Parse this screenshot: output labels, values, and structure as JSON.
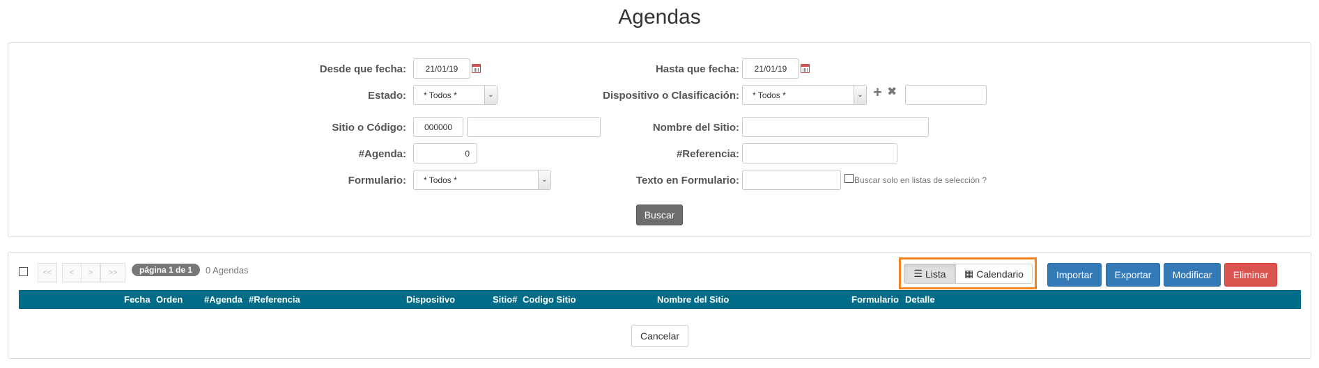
{
  "page": {
    "title": "Agendas"
  },
  "filters": {
    "desde_label": "Desde que fecha:",
    "desde_value": "21/01/19",
    "hasta_label": "Hasta que fecha:",
    "hasta_value": "21/01/19",
    "estado_label": "Estado:",
    "estado_value": "* Todos *",
    "dispositivo_label": "Dispositivo o Clasificación:",
    "dispositivo_value": "* Todos *",
    "dispositivo_extra_value": "",
    "sitio_label": "Sitio o Código:",
    "sitio_code_value": "000000",
    "sitio_text_value": "",
    "nombre_sitio_label": "Nombre del Sitio:",
    "nombre_sitio_value": "",
    "agenda_label": "#Agenda:",
    "agenda_value": "0",
    "referencia_label": "#Referencia:",
    "referencia_value": "",
    "formulario_label": "Formulario:",
    "formulario_value": "* Todos *",
    "texto_formulario_label": "Texto en Formulario:",
    "texto_formulario_value": "",
    "solo_listas_label": "Buscar solo en listas de selección ?",
    "buscar_label": "Buscar"
  },
  "icons": {
    "add": "+",
    "remove": "✖"
  },
  "results": {
    "pager": {
      "first": "<<",
      "prev": "<",
      "next": ">",
      "last": ">>"
    },
    "page_info": "página 1 de 1",
    "count": "0 Agendas",
    "view_toggle": {
      "lista": "Lista",
      "calendario": "Calendario"
    },
    "actions": {
      "importar": "Importar",
      "exportar": "Exportar",
      "modificar": "Modificar",
      "eliminar": "Eliminar"
    },
    "columns": [
      "Fecha",
      "Orden",
      "#Agenda",
      "#Referencia",
      "Dispositivo",
      "Sitio#",
      "Codigo Sitio",
      "Nombre del Sitio",
      "Formulario",
      "Detalle"
    ],
    "cancelar_label": "Cancelar"
  },
  "colors": {
    "table_header": "#006c88",
    "primary": "#337ab7",
    "danger": "#d9534f",
    "highlight": "#f58220"
  }
}
